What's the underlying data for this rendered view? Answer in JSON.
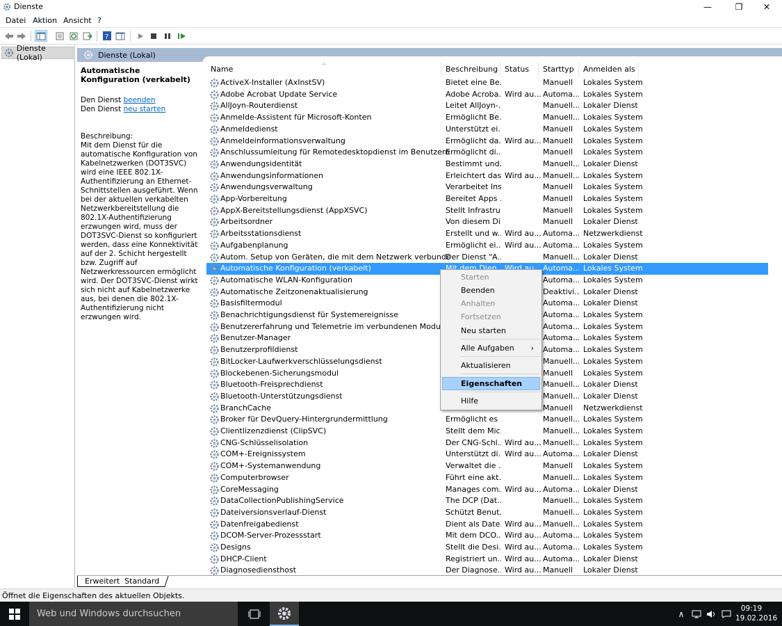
{
  "window": {
    "title": "Dienste",
    "minimize": "—",
    "maximize": "❐",
    "close": "✕"
  },
  "menu": [
    "Datei",
    "Aktion",
    "Ansicht",
    "?"
  ],
  "tree": {
    "item": "Dienste (Lokal)"
  },
  "main": {
    "header": "Dienste (Lokal)"
  },
  "description_pane": {
    "title": "Automatische Konfiguration (verkabelt)",
    "stop_prefix": "Den Dienst ",
    "stop_link": "beenden",
    "restart_prefix": "Den Dienst ",
    "restart_link": "neu starten",
    "desc_label": "Beschreibung:",
    "desc_text": "Mit dem Dienst für die automatische Konfiguration von Kabelnetzwerken (DOT3SVC) wird eine IEEE 802.1X-Authentifizierung an Ethernet-Schnittstellen ausgeführt. Wenn bei der aktuellen verkabelten Netzwerkbereitstellung die 802.1X-Authentifizierung erzwungen wird, muss der DOT3SVC-Dienst so konfiguriert werden, dass eine Konnektivität auf der 2. Schicht hergestellt bzw. Zugriff auf Netzwerkressourcen ermöglicht wird. Der DOT3SVC-Dienst wirkt sich nicht auf Kabelnetzwerke aus, bei denen die 802.1X-Authentifizierung nicht erzwungen wird."
  },
  "columns": {
    "name": "Name",
    "desc": "Beschreibung",
    "status": "Status",
    "start": "Starttyp",
    "logon": "Anmelden als",
    "sort_arrow": "^"
  },
  "services": [
    [
      "ActiveX-Installer (AxInstSV)",
      "Bietet eine Be...",
      "",
      "Manuell",
      "Lokales System"
    ],
    [
      "Adobe Acrobat Update Service",
      "Adobe Acroba...",
      "Wird au...",
      "Automa...",
      "Lokales System"
    ],
    [
      "AllJoyn-Routerdienst",
      "Leitet AllJoyn-...",
      "",
      "Manuell...",
      "Lokaler Dienst"
    ],
    [
      "Anmelde-Assistent für Microsoft-Konten",
      "Ermöglicht Be...",
      "",
      "Manuell...",
      "Lokales System"
    ],
    [
      "Anmeldedienst",
      "Unterstützt ei...",
      "",
      "Manuell",
      "Lokales System"
    ],
    [
      "Anmeldeinformationsverwaltung",
      "Ermöglicht da...",
      "Wird au...",
      "Manuell",
      "Lokales System"
    ],
    [
      "Anschlussumleitung für Remotedesktopdienst im Benutzermodus",
      "Ermöglicht di...",
      "",
      "Manuell",
      "Lokales System"
    ],
    [
      "Anwendungsidentität",
      "Bestimmt und...",
      "",
      "Manuell...",
      "Lokaler Dienst"
    ],
    [
      "Anwendungsinformationen",
      "Erleichtert das...",
      "Wird au...",
      "Manuell...",
      "Lokales System"
    ],
    [
      "Anwendungsverwaltung",
      "Verarbeitet Ins...",
      "",
      "Manuell",
      "Lokales System"
    ],
    [
      "App-Vorbereitung",
      "Bereitet Apps ...",
      "",
      "Manuell",
      "Lokales System"
    ],
    [
      "AppX-Bereitstellungsdienst (AppXSVC)",
      "Stellt Infrastru...",
      "",
      "Manuell",
      "Lokales System"
    ],
    [
      "Arbeitsordner",
      "Von diesem Di...",
      "",
      "Manuell",
      "Lokaler Dienst"
    ],
    [
      "Arbeitsstationsdienst",
      "Erstellt und w...",
      "Wird au...",
      "Automa...",
      "Netzwerkdienst"
    ],
    [
      "Aufgabenplanung",
      "Ermöglicht ei...",
      "Wird au...",
      "Automa...",
      "Lokales System"
    ],
    [
      "Autom. Setup von Geräten, die mit dem Netzwerk verbunden sind",
      "Der Dienst \"A...",
      "",
      "Manuell...",
      "Lokaler Dienst"
    ],
    [
      "Automatische Konfiguration (verkabelt)",
      "Mit dem Dien...",
      "Wird au...",
      "Automa...",
      "Lokales System"
    ],
    [
      "Automatische WLAN-Konfiguration",
      "",
      "",
      "Automa...",
      "Lokales System"
    ],
    [
      "Automatische Zeitzonenaktualisierung",
      "",
      "",
      "Deaktivi...",
      "Lokaler Dienst"
    ],
    [
      "Basisfiltermodul",
      "",
      "",
      "Automa...",
      "Lokaler Dienst"
    ],
    [
      "Benachrichtigungsdienst für Systemereignisse",
      "",
      "",
      "Automa...",
      "Lokales System"
    ],
    [
      "Benutzererfahrung und Telemetrie im verbundenen Modus",
      "",
      "",
      "Automa...",
      "Lokales System"
    ],
    [
      "Benutzer-Manager",
      "",
      "",
      "Automa...",
      "Lokales System"
    ],
    [
      "Benutzerprofildienst",
      "",
      "",
      "Automa...",
      "Lokales System"
    ],
    [
      "BitLocker-Laufwerkverschlüsselungsdienst",
      "",
      "",
      "Manuell...",
      "Lokales System"
    ],
    [
      "Blockebenen-Sicherungsmodul",
      "",
      "",
      "Manuell",
      "Lokales System"
    ],
    [
      "Bluetooth-Freisprechdienst",
      "",
      "",
      "Manuell...",
      "Lokaler Dienst"
    ],
    [
      "Bluetooth-Unterstützungsdienst",
      "",
      "",
      "Manuell...",
      "Lokaler Dienst"
    ],
    [
      "BranchCache",
      "",
      "",
      "Manuell",
      "Netzwerkdienst"
    ],
    [
      "Broker für DevQuery-Hintergrundermittlung",
      "Ermöglicht es ...",
      "",
      "Manuell...",
      "Lokales System"
    ],
    [
      "Clientlizenzdienst (ClipSVC)",
      "Stellt dem Mic...",
      "",
      "Manuell...",
      "Lokales System"
    ],
    [
      "CNG-Schlüsselisolation",
      "Der CNG-Schl...",
      "Wird au...",
      "Manuell...",
      "Lokales System"
    ],
    [
      "COM+-Ereignissystem",
      "Unterstützt di...",
      "Wird au...",
      "Automa...",
      "Lokaler Dienst"
    ],
    [
      "COM+-Systemanwendung",
      "Verwaltet die ...",
      "",
      "Manuell",
      "Lokales System"
    ],
    [
      "Computerbrowser",
      "Führt eine akt...",
      "",
      "Manuell...",
      "Lokales System"
    ],
    [
      "CoreMessaging",
      "Manages com...",
      "Wird au...",
      "Automa...",
      "Lokaler Dienst"
    ],
    [
      "DataCollectionPublishingService",
      "The DCP (Dat...",
      "",
      "Manuell...",
      "Lokales System"
    ],
    [
      "Dateiversionsverlauf-Dienst",
      "Schützt Benut...",
      "",
      "Manuell...",
      "Lokales System"
    ],
    [
      "Datenfreigabedienst",
      "Dient als Date...",
      "Wird au...",
      "Manuell...",
      "Lokales System"
    ],
    [
      "DCOM-Server-Prozessstart",
      "Mit dem DCO...",
      "Wird au...",
      "Automa...",
      "Lokales System"
    ],
    [
      "Designs",
      "Stellt die Desi...",
      "Wird au...",
      "Automa...",
      "Lokales System"
    ],
    [
      "DHCP-Client",
      "Registriert un...",
      "Wird au...",
      "Automa...",
      "Lokaler Dienst"
    ],
    [
      "Diagnosediensthost",
      "Der Diagnose...",
      "Wird au...",
      "Manuell",
      "Lokaler Dienst"
    ]
  ],
  "context_menu": {
    "items": [
      "Starten",
      "Beenden",
      "Anhalten",
      "Fortsetzen",
      "Neu starten",
      "Alle Aufgaben",
      "Aktualisieren",
      "Eigenschaften",
      "Hilfe"
    ],
    "submenu_arrow": "›"
  },
  "tabs": {
    "extended": "Erweitert",
    "standard": "Standard"
  },
  "status_bar": "Öffnet die Eigenschaften des aktuellen Objekts.",
  "taskbar": {
    "search_placeholder": "Web und Windows durchsuchen",
    "time": "09:19",
    "date": "19.02.2016",
    "tray_up": "∧"
  },
  "colors": {
    "selection": "#3399ff",
    "header": "#a7bbd3",
    "taskbar": "#0d1112"
  }
}
